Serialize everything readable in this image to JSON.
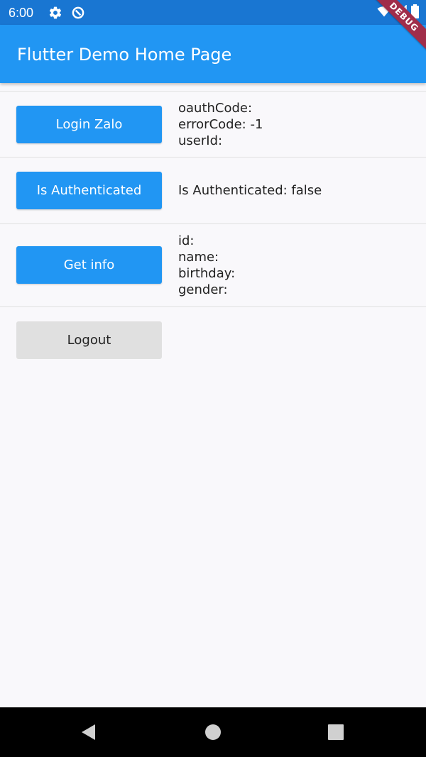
{
  "status_bar": {
    "time": "6:00",
    "icons": [
      "gear-icon",
      "sync-icon",
      "wifi-icon",
      "signal-icon",
      "battery-icon"
    ]
  },
  "debug_banner": "DEBUG",
  "app_bar": {
    "title": "Flutter Demo Home Page",
    "color": "#2196f3"
  },
  "rows": {
    "login": {
      "button_label": "Login Zalo",
      "lines": [
        "oauthCode:",
        "errorCode: -1",
        "userId:"
      ]
    },
    "auth": {
      "button_label": "Is Authenticated",
      "lines": [
        "Is Authenticated: false"
      ]
    },
    "info": {
      "button_label": "Get info",
      "lines": [
        "id:",
        "name:",
        "birthday:",
        "gender:"
      ]
    },
    "logout": {
      "button_label": "Logout"
    }
  },
  "nav_bar": {
    "icons": [
      "back-icon",
      "home-icon",
      "recents-icon"
    ]
  },
  "colors": {
    "status_bar": "#1976d2",
    "primary": "#2196f3",
    "secondary_button": "#e0e0e0",
    "background": "#f9f8fb"
  }
}
